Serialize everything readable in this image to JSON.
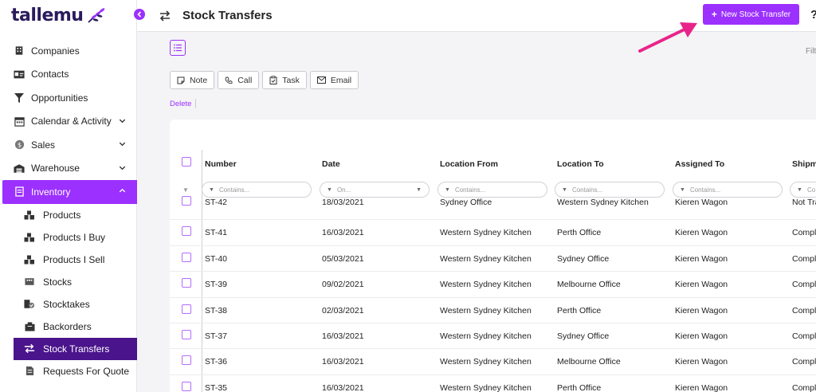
{
  "brand": {
    "name": "tallemu",
    "accent": "#9b30ff",
    "dark": "#4a148c"
  },
  "sidebar": {
    "items": [
      {
        "label": "Companies",
        "icon": "building-icon"
      },
      {
        "label": "Contacts",
        "icon": "contact-card-icon"
      },
      {
        "label": "Opportunities",
        "icon": "funnel-icon"
      },
      {
        "label": "Calendar & Activity",
        "icon": "calendar-icon",
        "expandable": true
      },
      {
        "label": "Sales",
        "icon": "dollar-icon",
        "expandable": true
      },
      {
        "label": "Warehouse",
        "icon": "warehouse-icon",
        "expandable": true
      },
      {
        "label": "Inventory",
        "icon": "inventory-icon",
        "expandable": true,
        "active": true
      }
    ],
    "subitems": [
      {
        "label": "Products",
        "icon": "boxes-icon"
      },
      {
        "label": "Products I Buy",
        "icon": "boxes-icon"
      },
      {
        "label": "Products I Sell",
        "icon": "boxes-icon"
      },
      {
        "label": "Stocks",
        "icon": "stock-icon"
      },
      {
        "label": "Stocktakes",
        "icon": "stocktake-icon"
      },
      {
        "label": "Backorders",
        "icon": "backorder-icon"
      },
      {
        "label": "Stock Transfers",
        "icon": "transfer-icon",
        "selected": true
      },
      {
        "label": "Requests For Quote",
        "icon": "document-icon"
      }
    ]
  },
  "header": {
    "title": "Stock Transfers",
    "new_button": "New Stock Transfer",
    "help": "?"
  },
  "toolbar": {
    "filter_label": "Filt",
    "actions": [
      "Note",
      "Call",
      "Task",
      "Email"
    ],
    "delete_label": "Delete"
  },
  "grid": {
    "columns": [
      "Number",
      "Date",
      "Location From",
      "Location To",
      "Assigned To",
      "Shipme"
    ],
    "filters": [
      "Contains...",
      "On...",
      "Contains...",
      "Contains...",
      "Contains...",
      "Co"
    ],
    "rows": [
      [
        "ST-42",
        "18/03/2021",
        "Sydney Office",
        "Western Sydney Kitchen",
        "Kieren Wagon",
        "Not Tra"
      ],
      [
        "ST-41",
        "16/03/2021",
        "Western Sydney Kitchen",
        "Perth Office",
        "Kieren Wagon",
        "Compl"
      ],
      [
        "ST-40",
        "05/03/2021",
        "Western Sydney Kitchen",
        "Sydney Office",
        "Kieren Wagon",
        "Compl"
      ],
      [
        "ST-39",
        "09/02/2021",
        "Western Sydney Kitchen",
        "Melbourne Office",
        "Kieren Wagon",
        "Compl"
      ],
      [
        "ST-38",
        "02/03/2021",
        "Western Sydney Kitchen",
        "Perth Office",
        "Kieren Wagon",
        "Compl"
      ],
      [
        "ST-37",
        "16/03/2021",
        "Western Sydney Kitchen",
        "Sydney Office",
        "Kieren Wagon",
        "Compl"
      ],
      [
        "ST-36",
        "16/03/2021",
        "Western Sydney Kitchen",
        "Melbourne Office",
        "Kieren Wagon",
        "Compl"
      ],
      [
        "ST-35",
        "16/03/2021",
        "Western Sydney Kitchen",
        "Perth Office",
        "Kieren Wagon",
        "Compl"
      ]
    ]
  }
}
